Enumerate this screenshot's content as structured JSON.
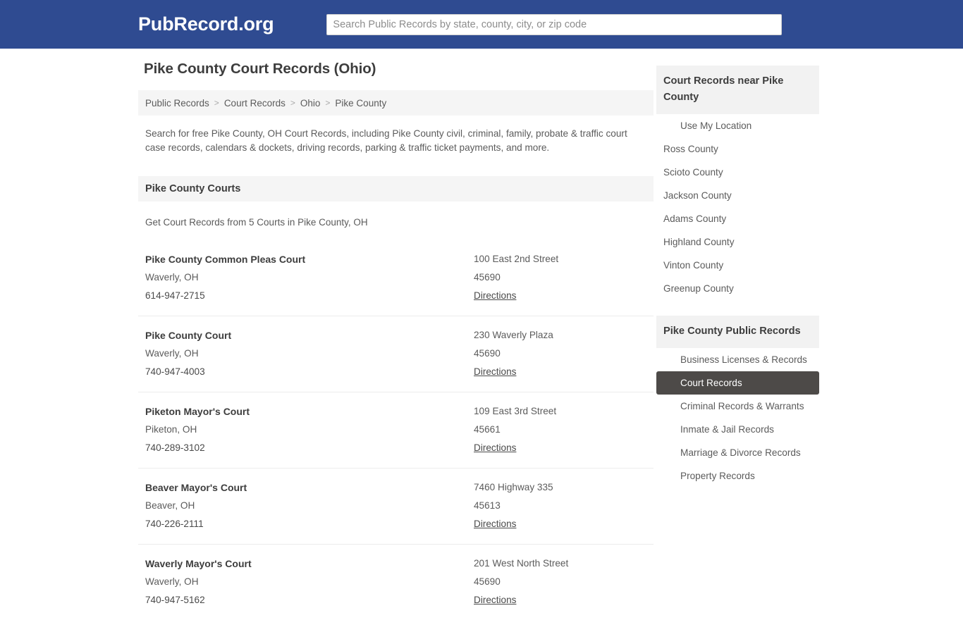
{
  "header": {
    "brand": "PubRecord.org",
    "search_placeholder": "Search Public Records by state, county, city, or zip code",
    "search_value": "",
    "brand_bg": "#2f4b91"
  },
  "page": {
    "title": "Pike County Court Records (Ohio)",
    "intro": "Search for free Pike County, OH Court Records, including Pike County civil, criminal, family, probate & traffic court case records, calendars & dockets, driving records, parking & traffic ticket payments, and more."
  },
  "breadcrumb": {
    "separator": ">",
    "items": [
      {
        "label": "Public Records"
      },
      {
        "label": "Court Records"
      },
      {
        "label": "Ohio"
      },
      {
        "label": "Pike County"
      }
    ]
  },
  "courts_section": {
    "heading": "Pike County Courts",
    "subtitle": "Get Court Records from 5 Courts in Pike County, OH",
    "directions_label": "Directions",
    "rows": [
      {
        "name": "Pike County Common Pleas Court",
        "city_state": "Waverly, OH",
        "phone": "614-947-2715",
        "street": "100 East 2nd Street",
        "zip": "45690",
        "directions": "Directions"
      },
      {
        "name": "Pike County Court",
        "city_state": "Waverly, OH",
        "phone": "740-947-4003",
        "street": "230 Waverly Plaza",
        "zip": "45690",
        "directions": "Directions"
      },
      {
        "name": "Piketon Mayor's Court",
        "city_state": "Piketon, OH",
        "phone": "740-289-3102",
        "street": "109 East 3rd Street",
        "zip": "45661",
        "directions": "Directions"
      },
      {
        "name": "Beaver Mayor's Court",
        "city_state": "Beaver, OH",
        "phone": "740-226-2111",
        "street": "7460 Highway 335",
        "zip": "45613",
        "directions": "Directions"
      },
      {
        "name": "Waverly Mayor's Court",
        "city_state": "Waverly, OH",
        "phone": "740-947-5162",
        "street": "201 West North Street",
        "zip": "45690",
        "directions": "Directions"
      }
    ]
  },
  "rail": {
    "nearby": {
      "heading": "Court Records near Pike County",
      "items": [
        {
          "label": "Use My Location",
          "indent": true
        },
        {
          "label": "Ross County",
          "indent": false
        },
        {
          "label": "Scioto County",
          "indent": false
        },
        {
          "label": "Jackson County",
          "indent": false
        },
        {
          "label": "Adams County",
          "indent": false
        },
        {
          "label": "Highland County",
          "indent": false
        },
        {
          "label": "Vinton County",
          "indent": false
        },
        {
          "label": "Greenup County",
          "indent": false
        }
      ]
    },
    "public_records": {
      "heading": "Pike County Public Records",
      "active_bg": "#4d4a48",
      "items": [
        {
          "label": "Business Licenses & Records",
          "active": false
        },
        {
          "label": "Court Records",
          "active": true
        },
        {
          "label": "Criminal Records & Warrants",
          "active": false
        },
        {
          "label": "Inmate & Jail Records",
          "active": false
        },
        {
          "label": "Marriage & Divorce Records",
          "active": false
        },
        {
          "label": "Property Records",
          "active": false
        }
      ]
    }
  }
}
